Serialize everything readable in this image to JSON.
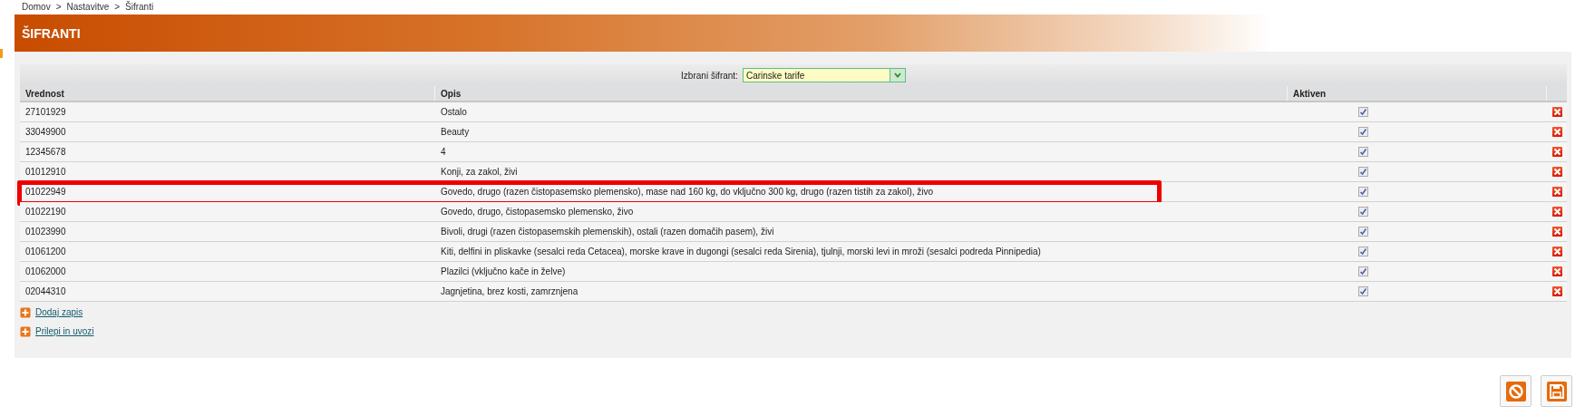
{
  "breadcrumb": [
    "Domov",
    "Nastavitve",
    "Šifranti"
  ],
  "breadcrumb_separator": ">",
  "page_title": "ŠIFRANTI",
  "selector": {
    "label": "Izbrani šifrant:",
    "value": "Carinske tarife"
  },
  "table": {
    "columns": [
      "Vrednost",
      "Opis",
      "Aktiven"
    ],
    "rows": [
      {
        "value": "27101929",
        "description": "Ostalo",
        "active": true,
        "highlighted": false
      },
      {
        "value": "33049900",
        "description": "Beauty",
        "active": true,
        "highlighted": false
      },
      {
        "value": "12345678",
        "description": "4",
        "active": true,
        "highlighted": false
      },
      {
        "value": "01012910",
        "description": "Konji, za zakol, živi",
        "active": true,
        "highlighted": false
      },
      {
        "value": "01022949",
        "description": "Govedo, drugo (razen čistopasemsko plemensko), mase nad 160 kg, do vključno 300 kg, drugo (razen tistih za zakol), živo",
        "active": true,
        "highlighted": true
      },
      {
        "value": "01022190",
        "description": "Govedo, drugo, čistopasemsko plemensko, živo",
        "active": true,
        "highlighted": false
      },
      {
        "value": "01023990",
        "description": "Bivoli, drugi (razen čistopasemskih plemenskih), ostali (razen domačih pasem), živi",
        "active": true,
        "highlighted": false
      },
      {
        "value": "01061200",
        "description": "Kiti, delfini in pliskavke (sesalci reda Cetacea), morske krave in dugongi (sesalci reda Sirenia), tjulnji, morski levi in mroži (sesalci podreda Pinnipedia)",
        "active": true,
        "highlighted": false
      },
      {
        "value": "01062000",
        "description": "Plazilci (vključno kače in želve)",
        "active": true,
        "highlighted": false
      },
      {
        "value": "02044310",
        "description": "Jagnjetina, brez kosti, zamrznjena",
        "active": true,
        "highlighted": false
      }
    ]
  },
  "links": [
    "Dodaj zapis",
    "Prilepi in uvozi"
  ]
}
